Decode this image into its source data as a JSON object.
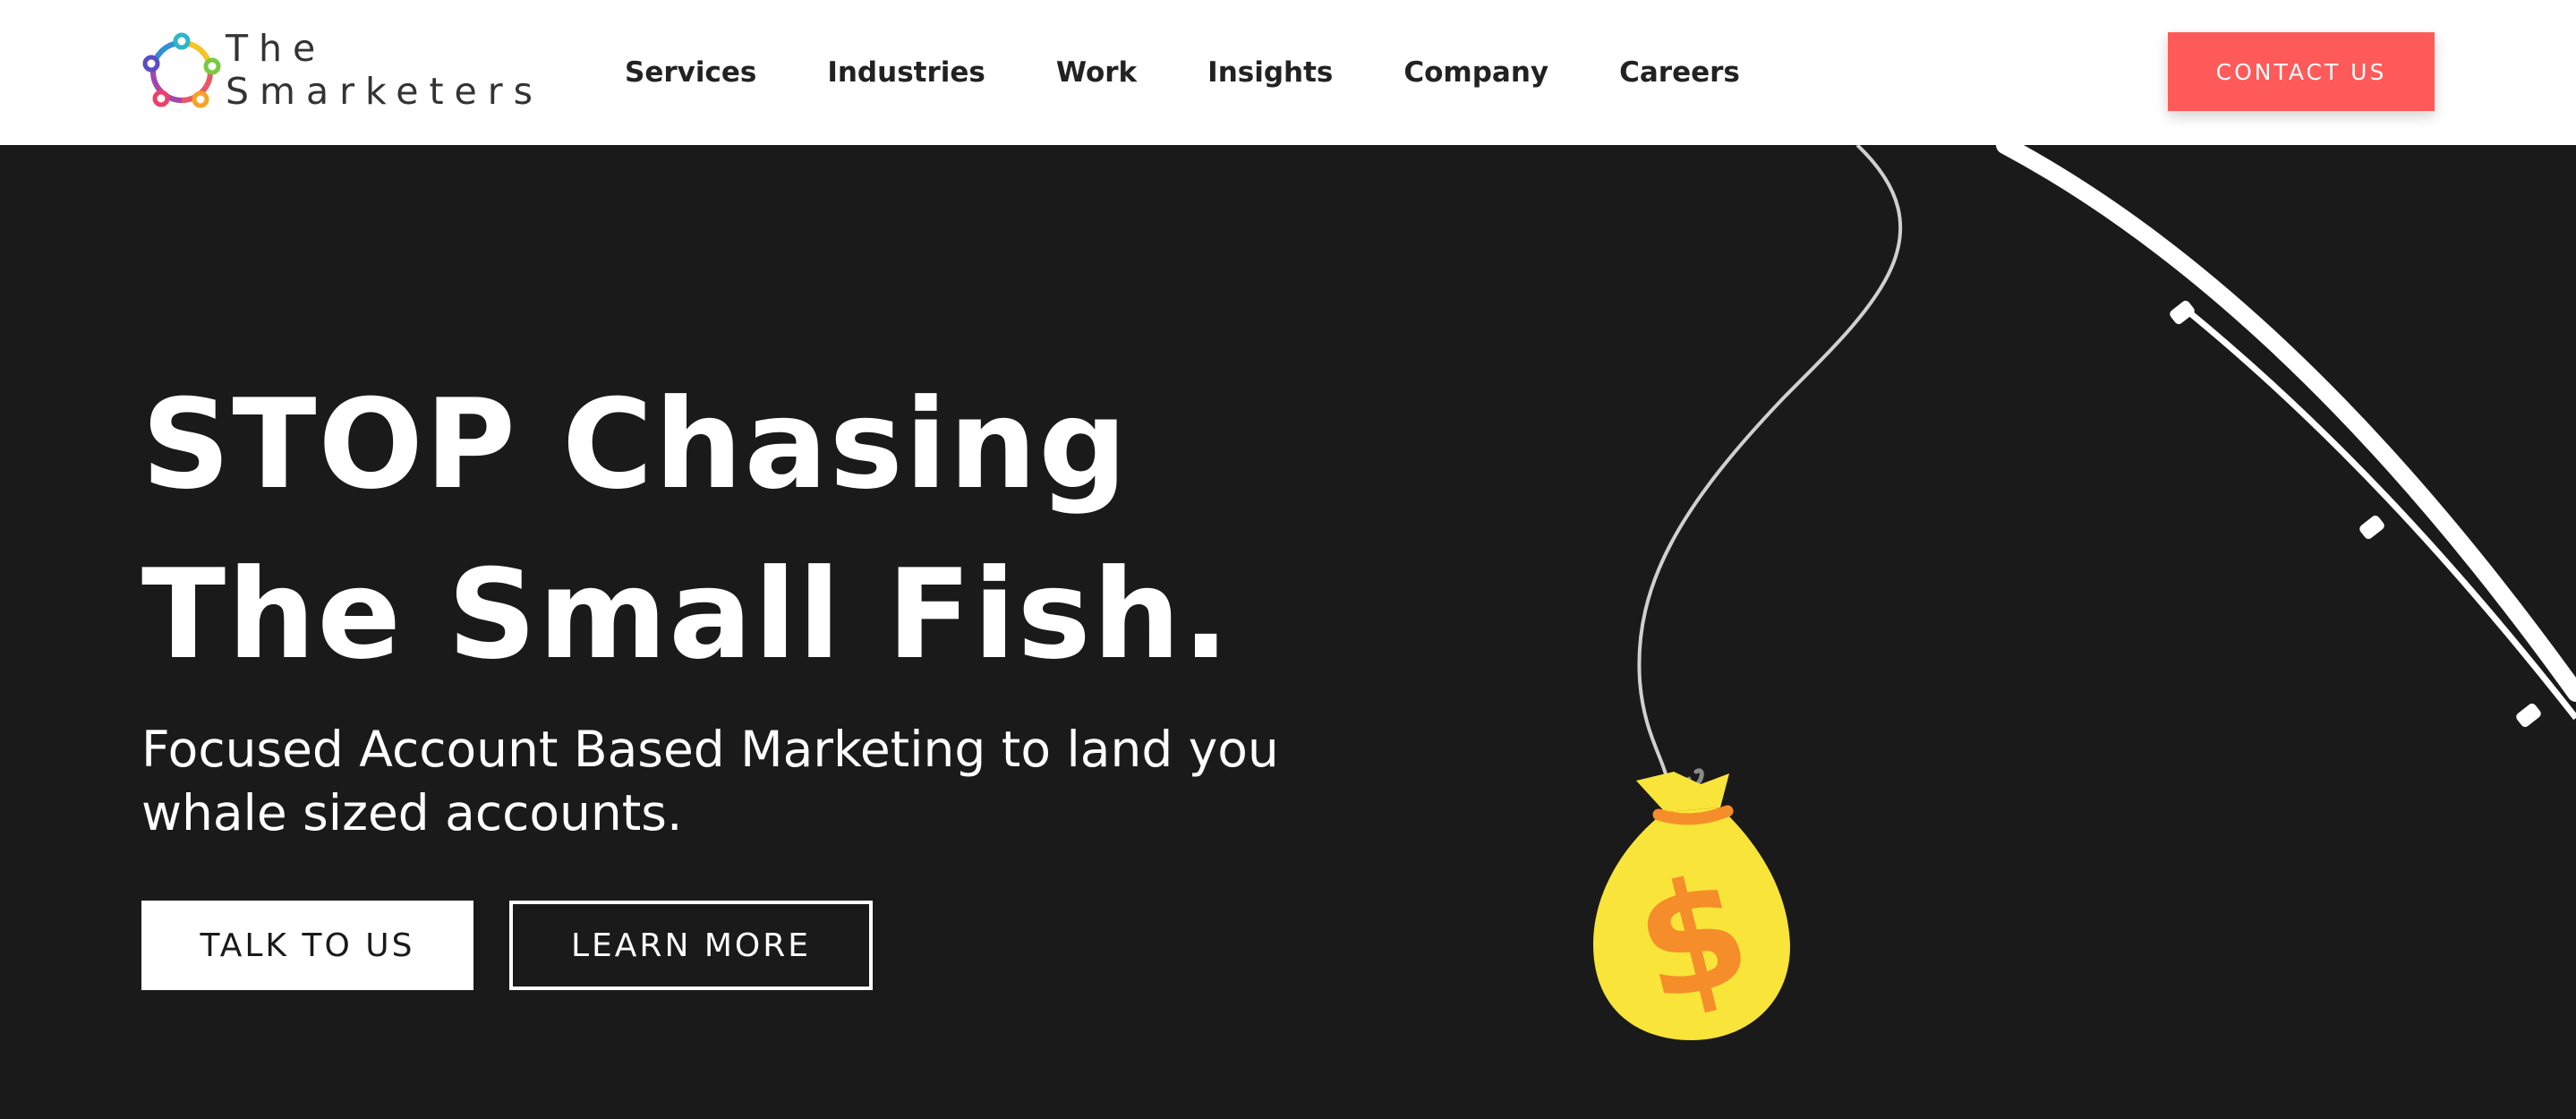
{
  "logo": {
    "line1": "The",
    "line2": "Smarketers"
  },
  "nav": {
    "items": [
      {
        "label": "Services"
      },
      {
        "label": "Industries"
      },
      {
        "label": "Work"
      },
      {
        "label": "Insights"
      },
      {
        "label": "Company"
      },
      {
        "label": "Careers"
      }
    ],
    "contact_label": "CONTACT US"
  },
  "hero": {
    "headline_line1": "STOP Chasing",
    "headline_line2": "The Small Fish.",
    "subtitle": "Focused Account Based Marketing to land you whale sized accounts.",
    "primary_button": "TALK TO US",
    "secondary_button": "LEARN MORE",
    "bag_symbol": "$"
  },
  "colors": {
    "accent": "#ff5a5a",
    "hero_background": "#1a1a1a",
    "bag": "#f9e43a",
    "bag_symbol": "#f58d2a"
  },
  "icons": [
    "logo-mark-icon",
    "fishing-rod-icon",
    "fishing-line-icon",
    "hook-icon",
    "money-bag-icon"
  ]
}
